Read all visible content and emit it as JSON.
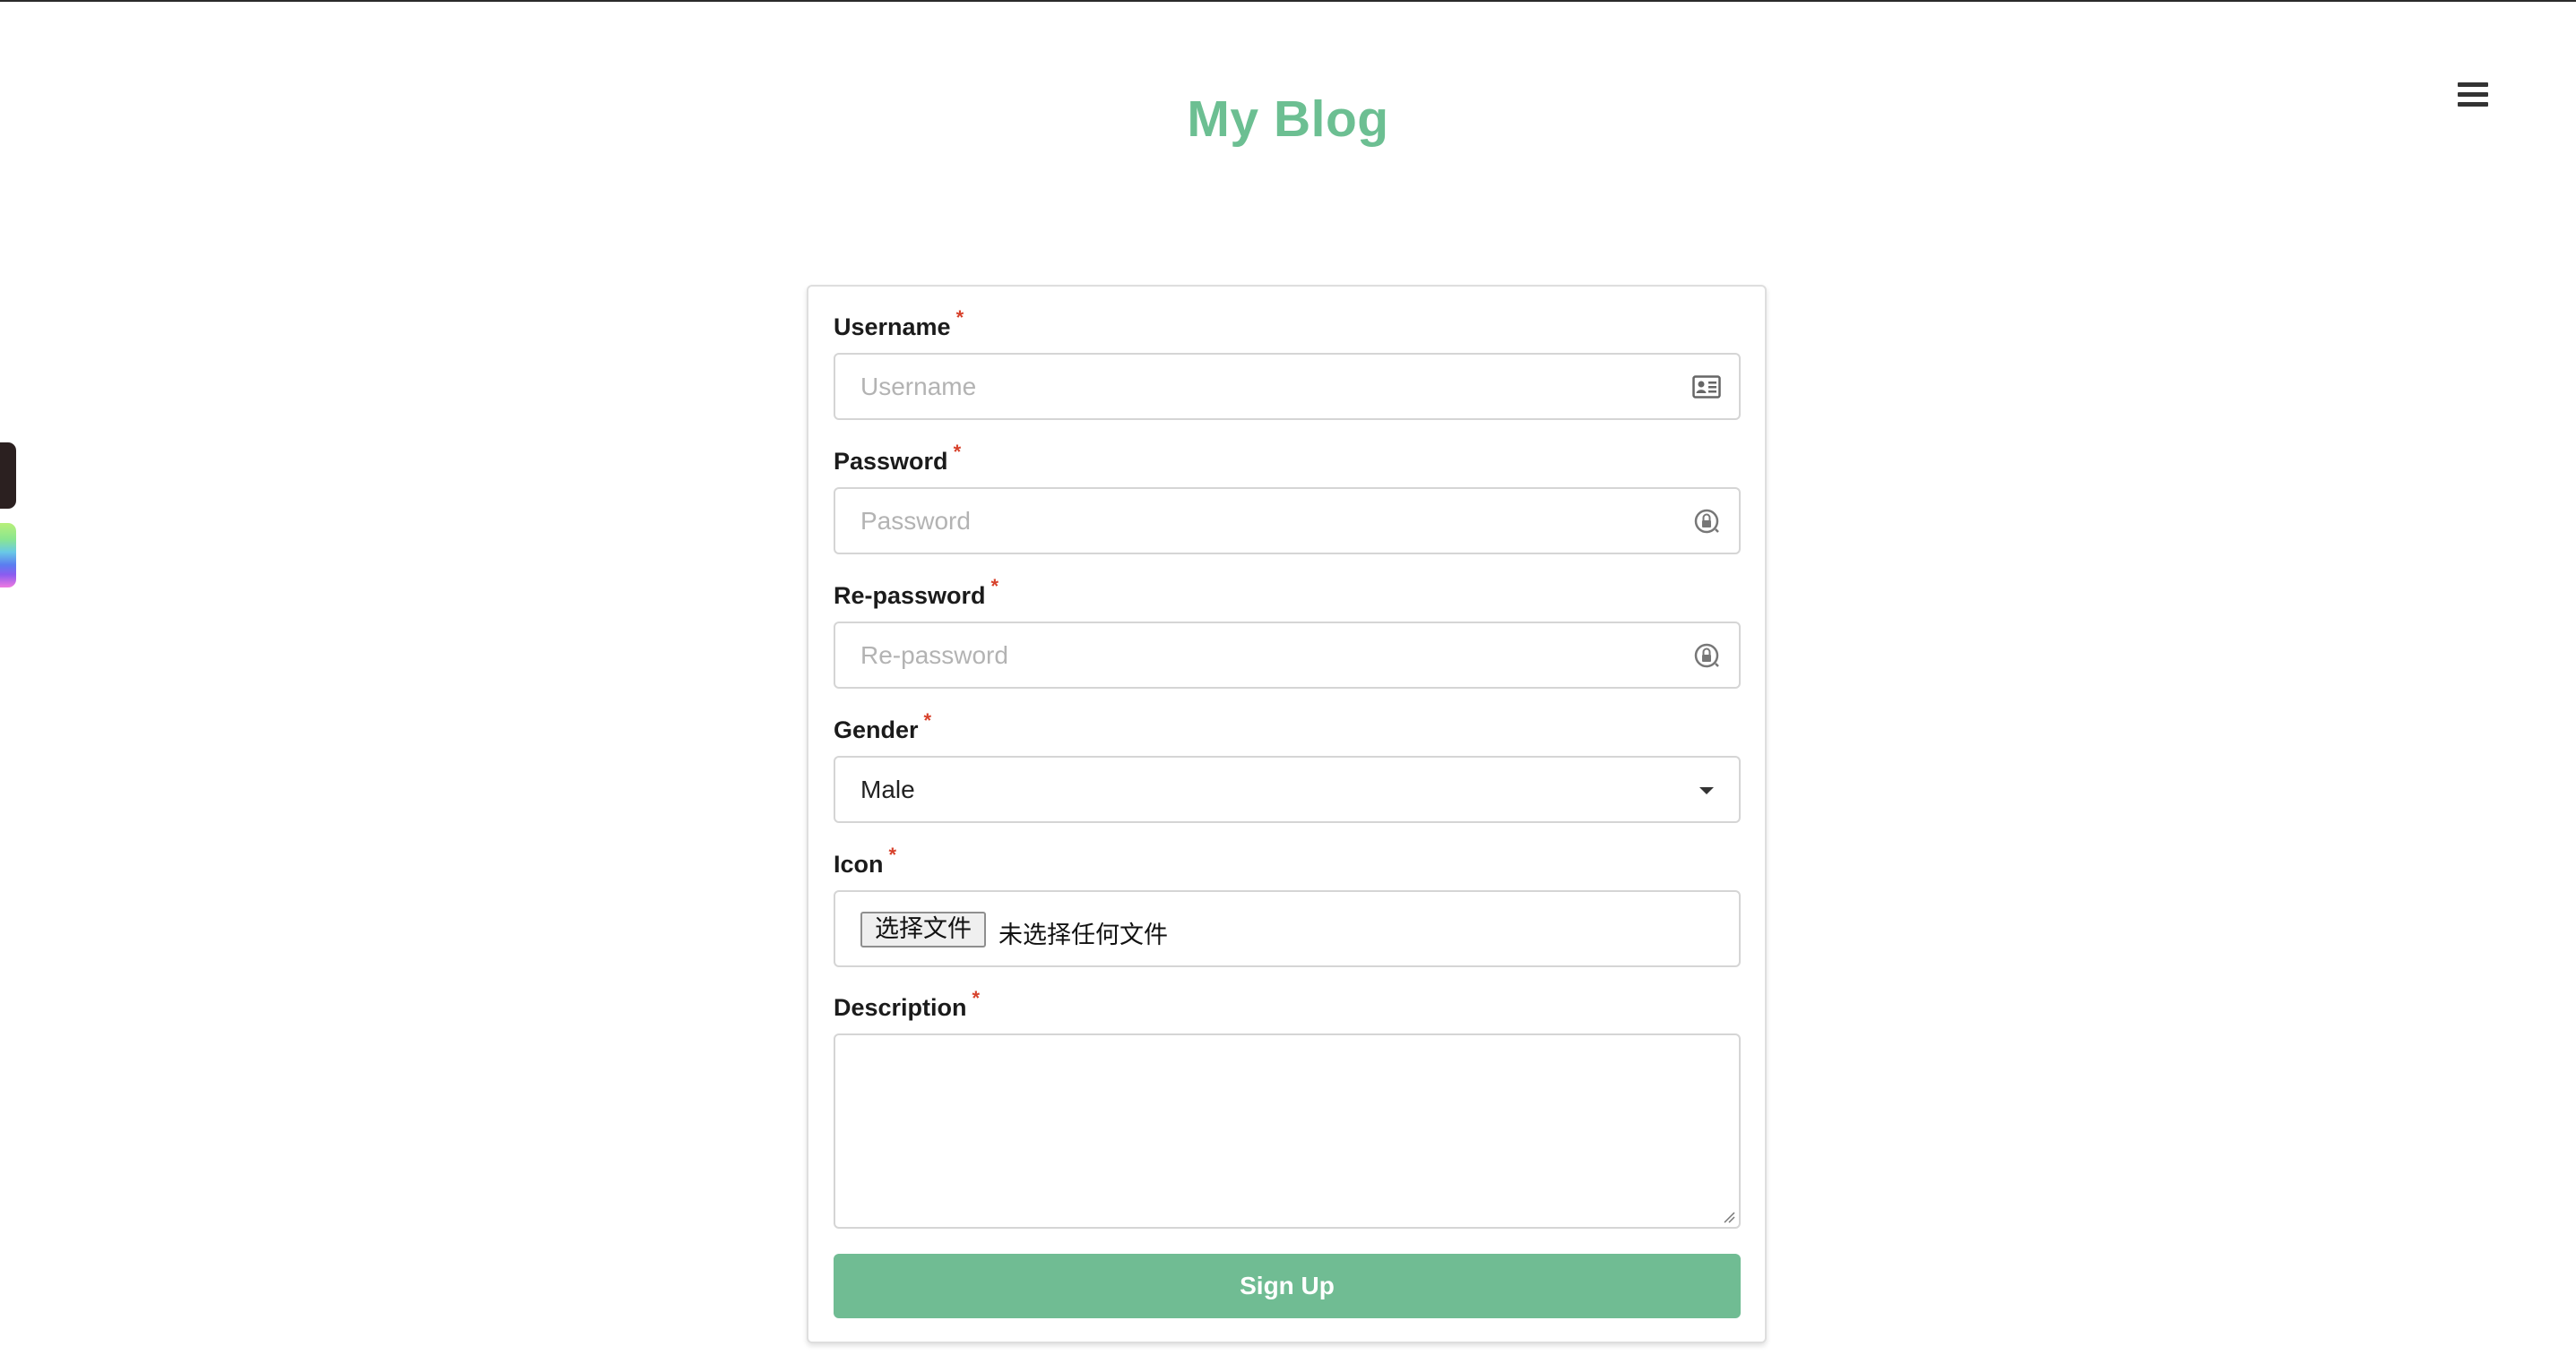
{
  "header": {
    "title": "My Blog",
    "menu_icon": "hamburger-menu-icon"
  },
  "form": {
    "required_marker": "*",
    "username": {
      "label": "Username",
      "placeholder": "Username",
      "value": "",
      "icon": "id-card-icon"
    },
    "password": {
      "label": "Password",
      "placeholder": "Password",
      "value": "",
      "icon": "lock-icon"
    },
    "repassword": {
      "label": "Re-password",
      "placeholder": "Re-password",
      "value": "",
      "icon": "lock-icon"
    },
    "gender": {
      "label": "Gender",
      "selected": "Male",
      "icon": "caret-down-icon"
    },
    "icon_upload": {
      "label": "Icon",
      "button_label": "选择文件",
      "status_text": "未选择任何文件"
    },
    "description": {
      "label": "Description",
      "value": ""
    },
    "submit_label": "Sign Up"
  },
  "colors": {
    "brand": "#6cbf92",
    "button": "#70bc93",
    "required": "#d7412b",
    "border": "#d5d5d5"
  }
}
